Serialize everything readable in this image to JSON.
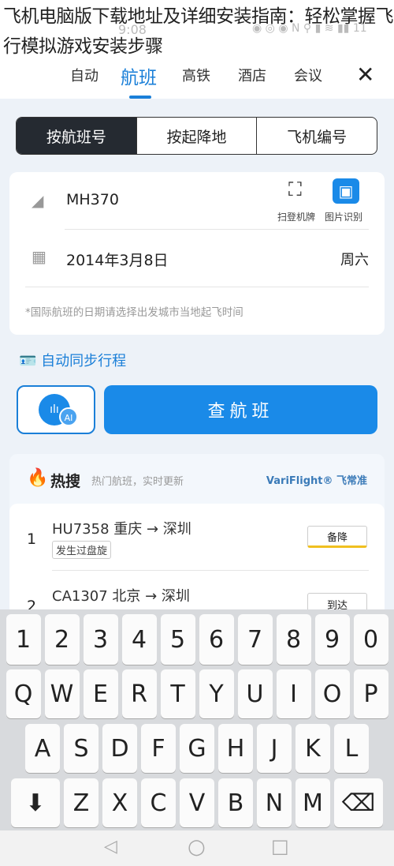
{
  "overlay_title": "飞机电脑版下载地址及详细安装指南：轻松掌握飞行模拟游戏安装步骤",
  "status": {
    "time": "9:08",
    "battery": "11"
  },
  "tabs": [
    {
      "label": "自动"
    },
    {
      "label": "航班",
      "active": true
    },
    {
      "label": "高铁"
    },
    {
      "label": "酒店"
    },
    {
      "label": "会议"
    }
  ],
  "segments": [
    "按航班号",
    "按起降地",
    "飞机编号"
  ],
  "form": {
    "flight_no": "MH370",
    "scan_label": "扫登机牌",
    "image_label": "图片识别",
    "date": "2014年3月8日",
    "weekday": "周六",
    "note": "*国际航班的日期请选择出发城市当地起飞时间"
  },
  "sync_label": "自动同步行程",
  "search_label": "查航班",
  "voice_badge": "AI",
  "hot": {
    "title": "热搜",
    "subtitle": "热门航班，实时更新",
    "brand": "VariFlight® 飞常准",
    "items": [
      {
        "rank": "1",
        "flight": "HU7358 重庆 → 深圳",
        "tag": "发生过盘旋",
        "status": "备降",
        "status_color": "#f0c020"
      },
      {
        "rank": "2",
        "flight": "CA1307 北京 → 深圳",
        "status": "到达",
        "status_color": "#cccccc"
      }
    ]
  },
  "keyboard": {
    "rows": [
      [
        "1",
        "2",
        "3",
        "4",
        "5",
        "6",
        "7",
        "8",
        "9",
        "0"
      ],
      [
        "Q",
        "W",
        "E",
        "R",
        "T",
        "Y",
        "U",
        "I",
        "O",
        "P"
      ],
      [
        "A",
        "S",
        "D",
        "F",
        "G",
        "H",
        "J",
        "K",
        "L"
      ],
      [
        "⬇",
        "Z",
        "X",
        "C",
        "V",
        "B",
        "N",
        "M",
        "⌫"
      ]
    ]
  },
  "nav": [
    "◁",
    "○",
    "□"
  ],
  "colors": {
    "accent": "#1a7fd8",
    "dark_segment": "#252a31"
  }
}
